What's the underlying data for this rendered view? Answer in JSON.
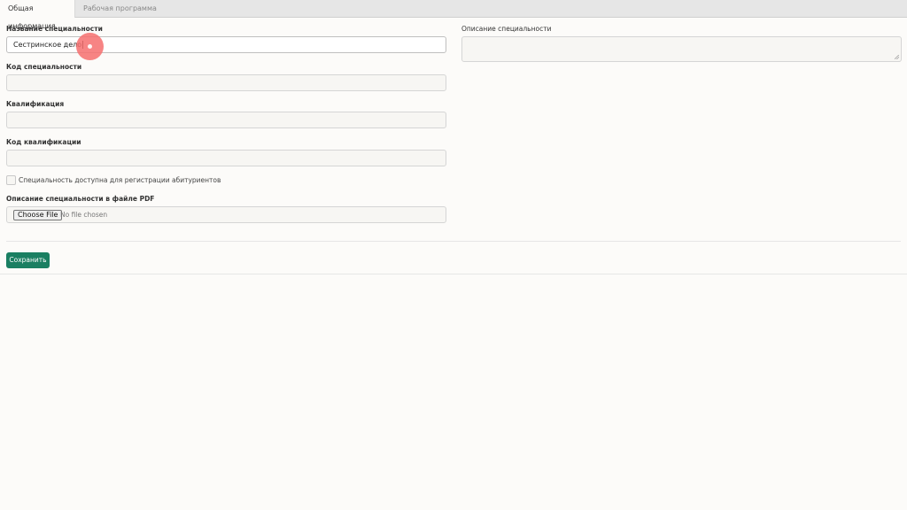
{
  "tabs": {
    "general": "Общая информация",
    "program": "Рабочая программа"
  },
  "form": {
    "name_label": "Название специальности",
    "name_value": "Сестринское дело",
    "code_label": "Код специальности",
    "code_value": "",
    "qualification_label": "Квалификация",
    "qualification_value": "",
    "qualification_code_label": "Код квалификации",
    "qualification_code_value": "",
    "description_label": "Описание специальности",
    "available_label": "Специальность доступна для регистрации абитуриентов",
    "available_checked": false,
    "pdf_label": "Описание специальности в файле PDF",
    "file_button": "Choose File",
    "file_status": "No file chosen",
    "save_label": "Сохранить"
  },
  "colors": {
    "accent": "#1a7f62",
    "click_indicator": "#f66e6e"
  }
}
